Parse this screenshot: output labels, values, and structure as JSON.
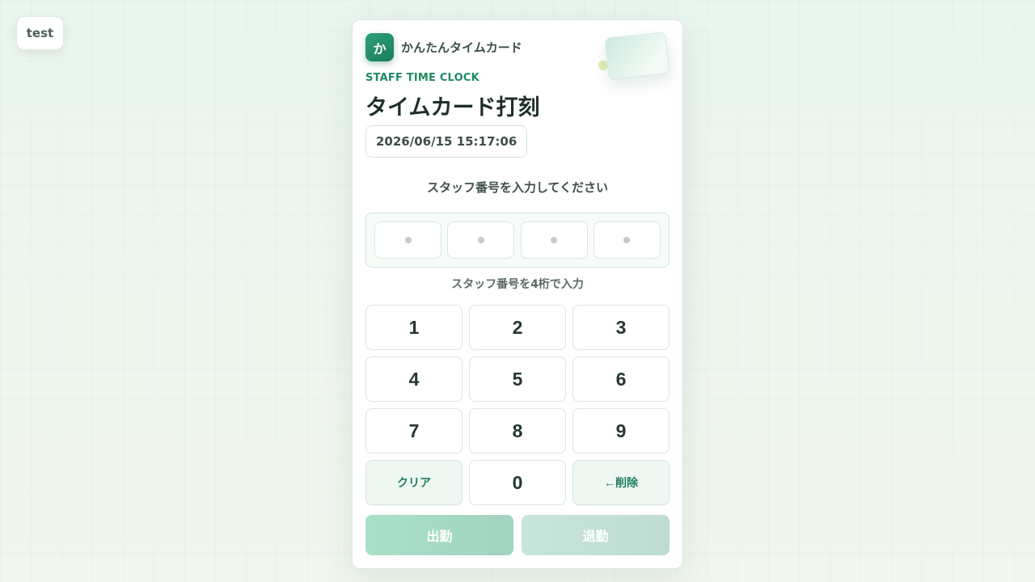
{
  "badge": {
    "label": "test"
  },
  "brand": {
    "logo_char": "か",
    "name": "かんたんタイムカード"
  },
  "header": {
    "eyebrow": "STAFF TIME CLOCK",
    "title": "タイムカード打刻",
    "datetime": "2026/06/15 15:17:06"
  },
  "pin": {
    "prompt": "スタッフ番号を入力してください",
    "digits": 4,
    "entered": 0,
    "hint": "スタッフ番号を4桁で入力"
  },
  "keypad": {
    "keys": [
      "1",
      "2",
      "3",
      "4",
      "5",
      "6",
      "7",
      "8",
      "9"
    ],
    "clear_label": "クリア",
    "zero_label": "0",
    "delete_label": "←削除"
  },
  "actions": {
    "clock_in_label": "出勤",
    "clock_out_label": "退勤"
  },
  "colors": {
    "accent": "#1f8a62",
    "clock_in": "#a9e0c8",
    "clock_out": "#c8e5dc"
  }
}
